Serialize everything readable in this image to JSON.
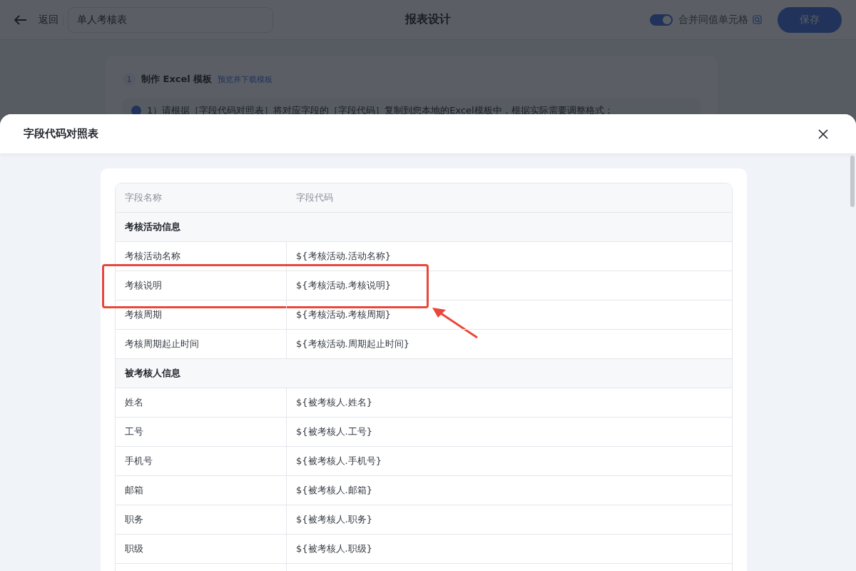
{
  "header": {
    "back_label": "返回",
    "name_value": "单人考核表",
    "title": "报表设计",
    "merge_toggle": {
      "label": "合并同值单元格",
      "on": true
    },
    "save_label": "保存"
  },
  "step": {
    "number": "1",
    "title": "制作 Excel 模板",
    "link": "预览并下载模板",
    "tip": "1）请根据［字段代码对照表］将对应字段的［字段代码］复制到您本地的Excel模板中，根据实际需要调整格式；"
  },
  "dialog": {
    "title": "字段代码对照表",
    "columns": [
      "字段名称",
      "字段代码"
    ],
    "sections": [
      {
        "title": "考核活动信息",
        "rows": [
          {
            "name": "考核活动名称",
            "code": "${考核活动.活动名称}",
            "highlighted": false
          },
          {
            "name": "考核说明",
            "code": "${考核活动.考核说明}",
            "highlighted": true
          },
          {
            "name": "考核周期",
            "code": "${考核活动.考核周期}",
            "highlighted": false
          },
          {
            "name": "考核周期起止时间",
            "code": "${考核活动.周期起止时间}",
            "highlighted": false
          }
        ]
      },
      {
        "title": "被考核人信息",
        "rows": [
          {
            "name": "姓名",
            "code": "${被考核人.姓名}",
            "highlighted": false
          },
          {
            "name": "工号",
            "code": "${被考核人.工号}",
            "highlighted": false
          },
          {
            "name": "手机号",
            "code": "${被考核人.手机号}",
            "highlighted": false
          },
          {
            "name": "邮箱",
            "code": "${被考核人.邮箱}",
            "highlighted": false
          },
          {
            "name": "职务",
            "code": "${被考核人.职务}",
            "highlighted": false
          },
          {
            "name": "职级",
            "code": "${被考核人.职级}",
            "highlighted": false
          }
        ]
      }
    ]
  }
}
